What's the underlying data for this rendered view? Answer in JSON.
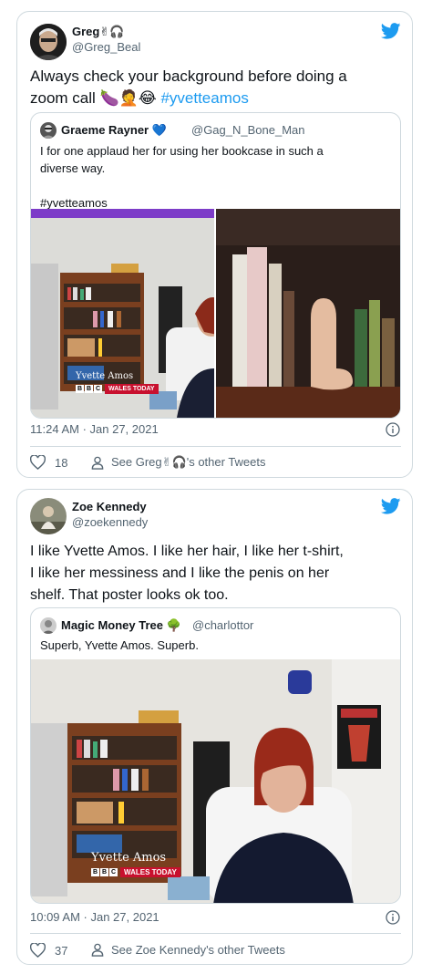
{
  "tweets": [
    {
      "name": "Greg",
      "name_emoji": "✌🎧",
      "handle": "@Greg_Beal",
      "text_main": "Always check your background before doing a zoom call 🍆🤦‍♂️😂",
      "text_line1": "Always check your background before doing a",
      "text_line2": "zoom call 🍆🤦😂 ",
      "hashtag": "#yvetteamos",
      "quote": {
        "name": "Graeme Rayner",
        "verified_emoji": "💙",
        "handle": "@Gag_N_Bone_Man",
        "text_line1": "I for one applaud her for using her bookcase in such a",
        "text_line2": "diverse way.",
        "hashtag": "#yvetteamos",
        "lower_third_name": "Yvette Amos",
        "lower_third_channel": "WALES TODAY"
      },
      "timestamp": "11:24 AM · Jan 27, 2021",
      "likes": "18",
      "see_other": "See Greg✌🎧's other Tweets"
    },
    {
      "name": "Zoe Kennedy",
      "handle": "@zoekennedy",
      "text_line1": "I like Yvette Amos. I like her hair, I like her t-shirt,",
      "text_line2": "I like her messiness and I like the penis on her",
      "text_line3": "shelf. That poster looks ok too.",
      "quote": {
        "name": "Magic Money Tree",
        "name_emoji": "🌳",
        "handle": "@charlottor",
        "text": "Superb, Yvette Amos. Superb.",
        "lower_third_name": "Yvette Amos",
        "lower_third_channel": "WALES TODAY"
      },
      "timestamp": "10:09 AM · Jan 27, 2021",
      "likes": "37",
      "see_other": "See Zoe Kennedy's other Tweets"
    }
  ],
  "colors": {
    "twitter_blue": "#1d9bf0",
    "border": "#cfd9de",
    "secondary_text": "#536471"
  },
  "icons": [
    "twitter-bird-icon",
    "info-icon",
    "heart-icon",
    "person-icon"
  ]
}
